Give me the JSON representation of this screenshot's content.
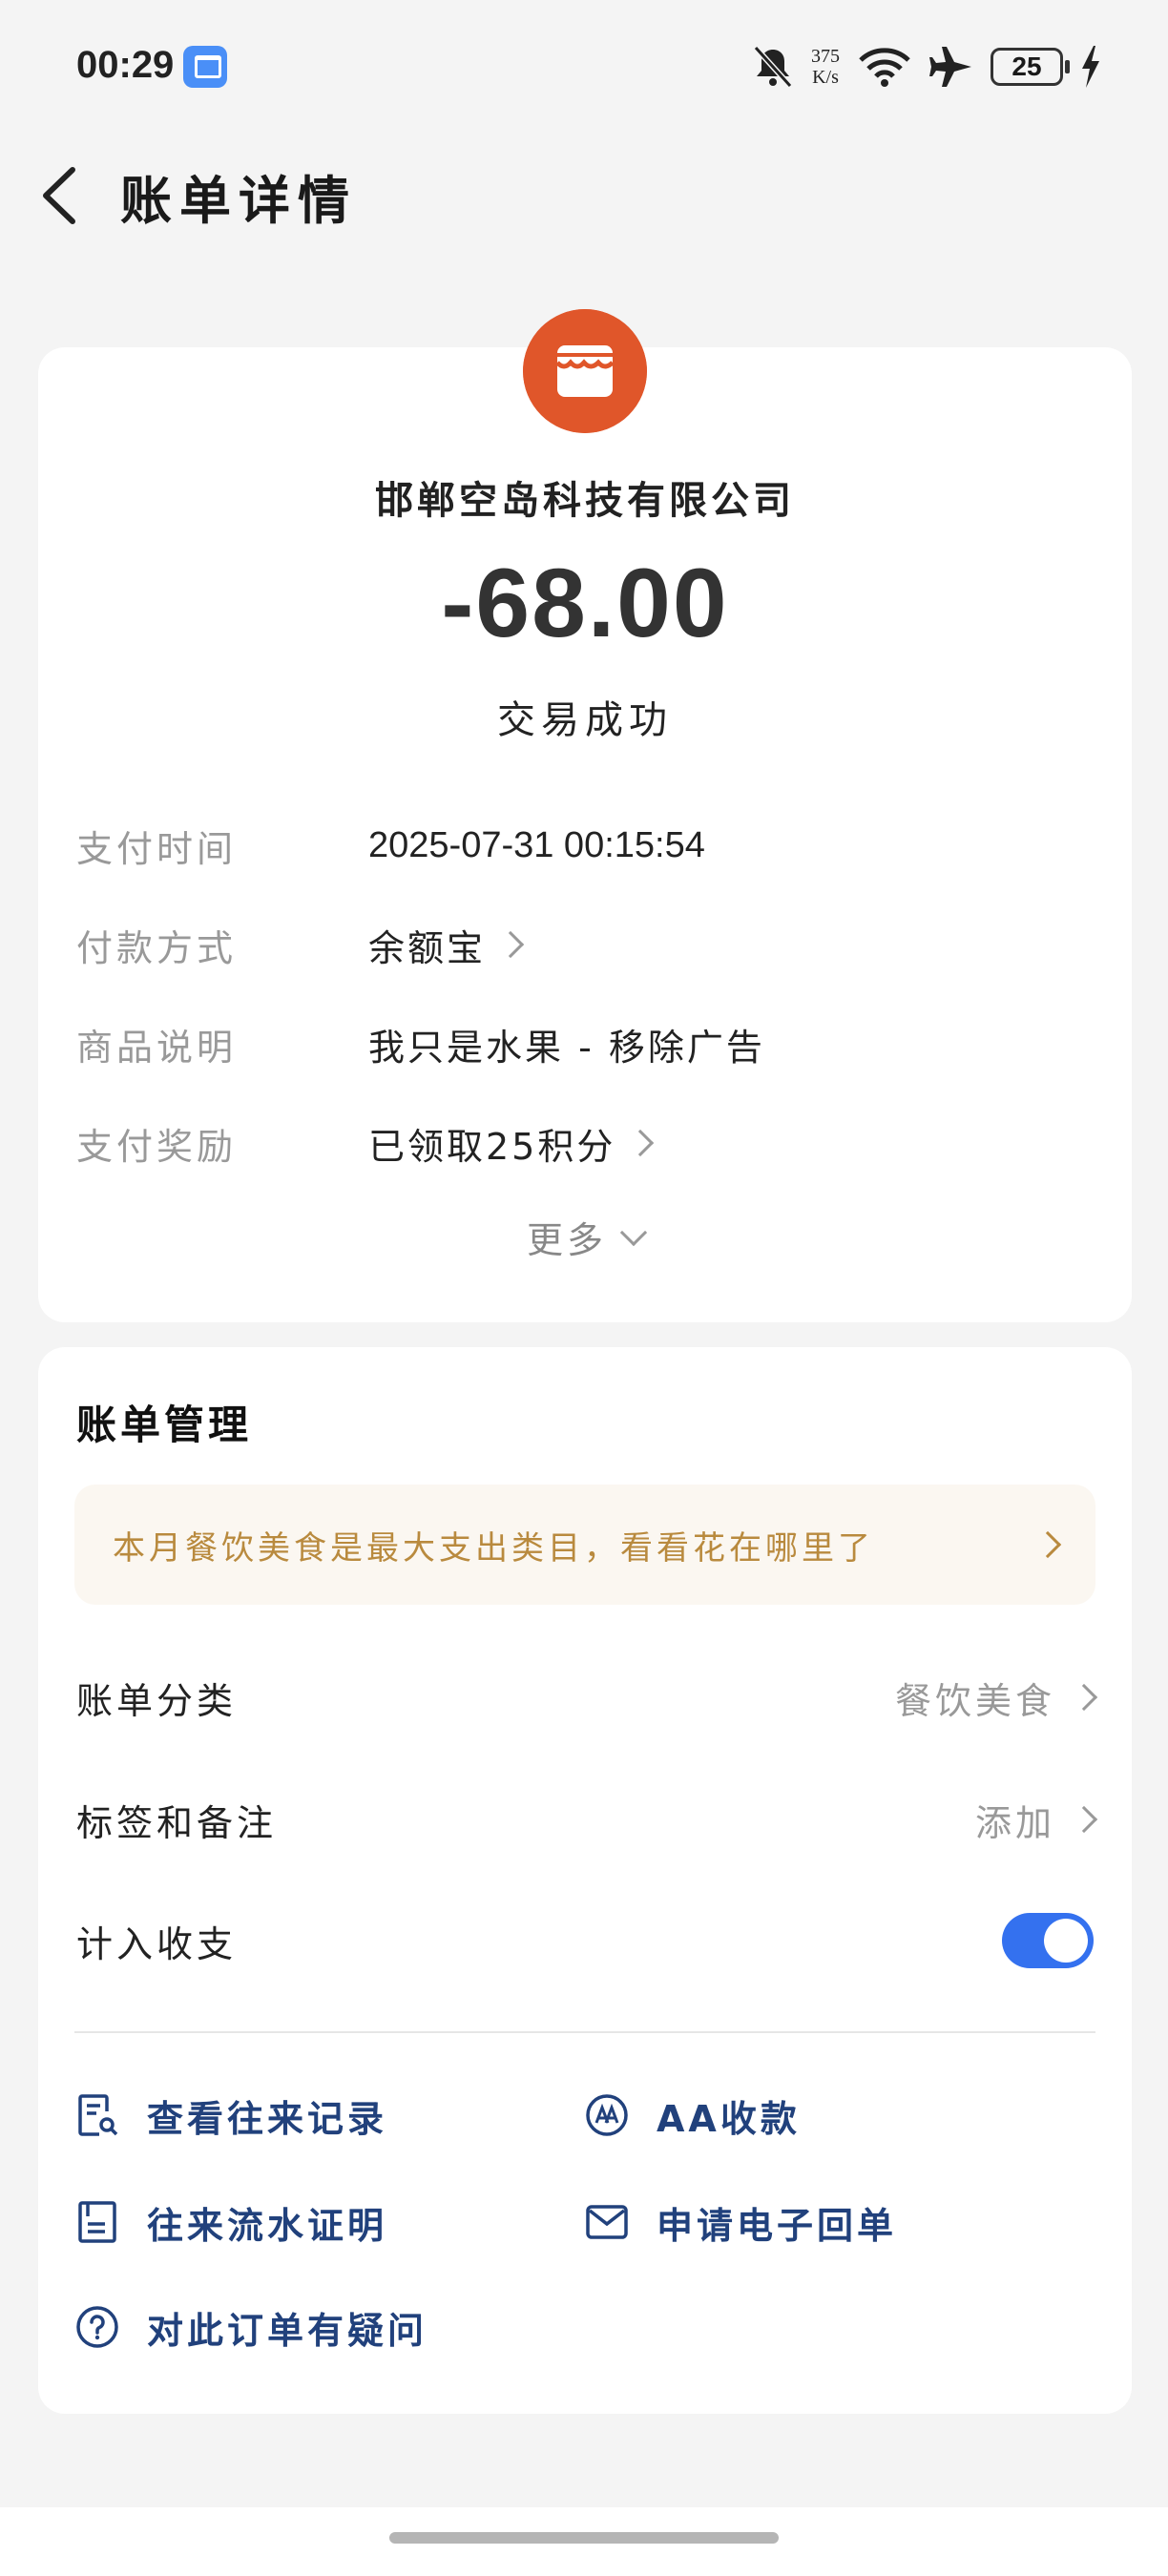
{
  "status_bar": {
    "time": "00:29",
    "net_speed_value": "375",
    "net_speed_unit": "K/s",
    "battery": "25",
    "icons": [
      "bell-muted-icon",
      "wifi-icon",
      "airplane-icon",
      "charging-icon"
    ]
  },
  "header": {
    "title": "账单详情",
    "back_icon": "chevron-left-icon"
  },
  "detail": {
    "merchant_icon": "store-icon",
    "merchant_color": "#e0562a",
    "merchant_name": "邯郸空岛科技有限公司",
    "amount": "-68.00",
    "status": "交易成功",
    "rows": [
      {
        "label": "支付时间",
        "value": "2025-07-31 00:15:54"
      },
      {
        "label": "付款方式",
        "value": "余额宝"
      },
      {
        "label": "商品说明",
        "value": "我只是水果 - 移除广告"
      },
      {
        "label": "支付奖励",
        "value": "已领取25积分"
      }
    ],
    "more": "更多"
  },
  "management": {
    "title": "账单管理",
    "banner": "本月餐饮美食是最大支出类目，看看花在哪里了",
    "category_label": "账单分类",
    "category_value": "餐饮美食",
    "tags_label": "标签和备注",
    "tags_value": "添加",
    "include_label": "计入收支",
    "include_enabled": true,
    "accent_color": "#3471ef",
    "actions": [
      {
        "label": "查看往来记录",
        "icon": "record-search-icon"
      },
      {
        "label": "AA收款",
        "icon": "aa-icon"
      },
      {
        "label": "往来流水证明",
        "icon": "document-icon"
      },
      {
        "label": "申请电子回单",
        "icon": "mail-icon"
      },
      {
        "label": "对此订单有疑问",
        "icon": "help-icon"
      }
    ]
  }
}
